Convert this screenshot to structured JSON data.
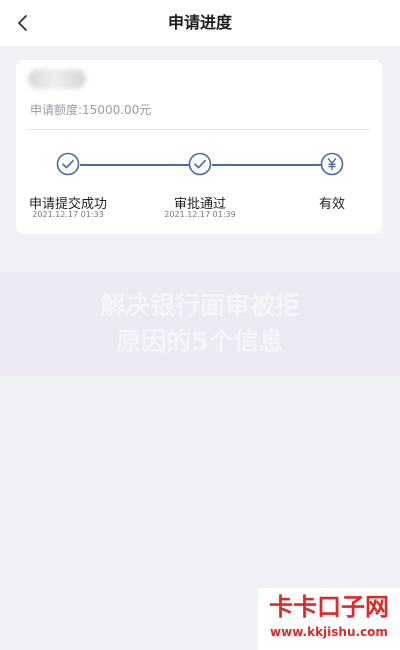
{
  "header": {
    "title": "申请进度",
    "back_icon": "chevron-left-icon"
  },
  "card": {
    "applicant_name": "",
    "amount_text": "申请额度:15000.00元"
  },
  "progress": {
    "line_color": "#4a6aa3",
    "steps": [
      {
        "label": "申请提交成功",
        "time": "2021.12.17 01:33",
        "icon": "check-circle-icon"
      },
      {
        "label": "审批通过",
        "time": "2021.12.17 01:39",
        "icon": "check-circle-icon"
      },
      {
        "label": "有效",
        "time": "",
        "icon": "yen-circle-icon"
      }
    ]
  },
  "watermark": {
    "line1": "解决银行面审被拒",
    "line2": "原因的5个信息"
  },
  "site_logo": {
    "brand": "卡卡口子网",
    "url": "www.kkjishu.com"
  }
}
